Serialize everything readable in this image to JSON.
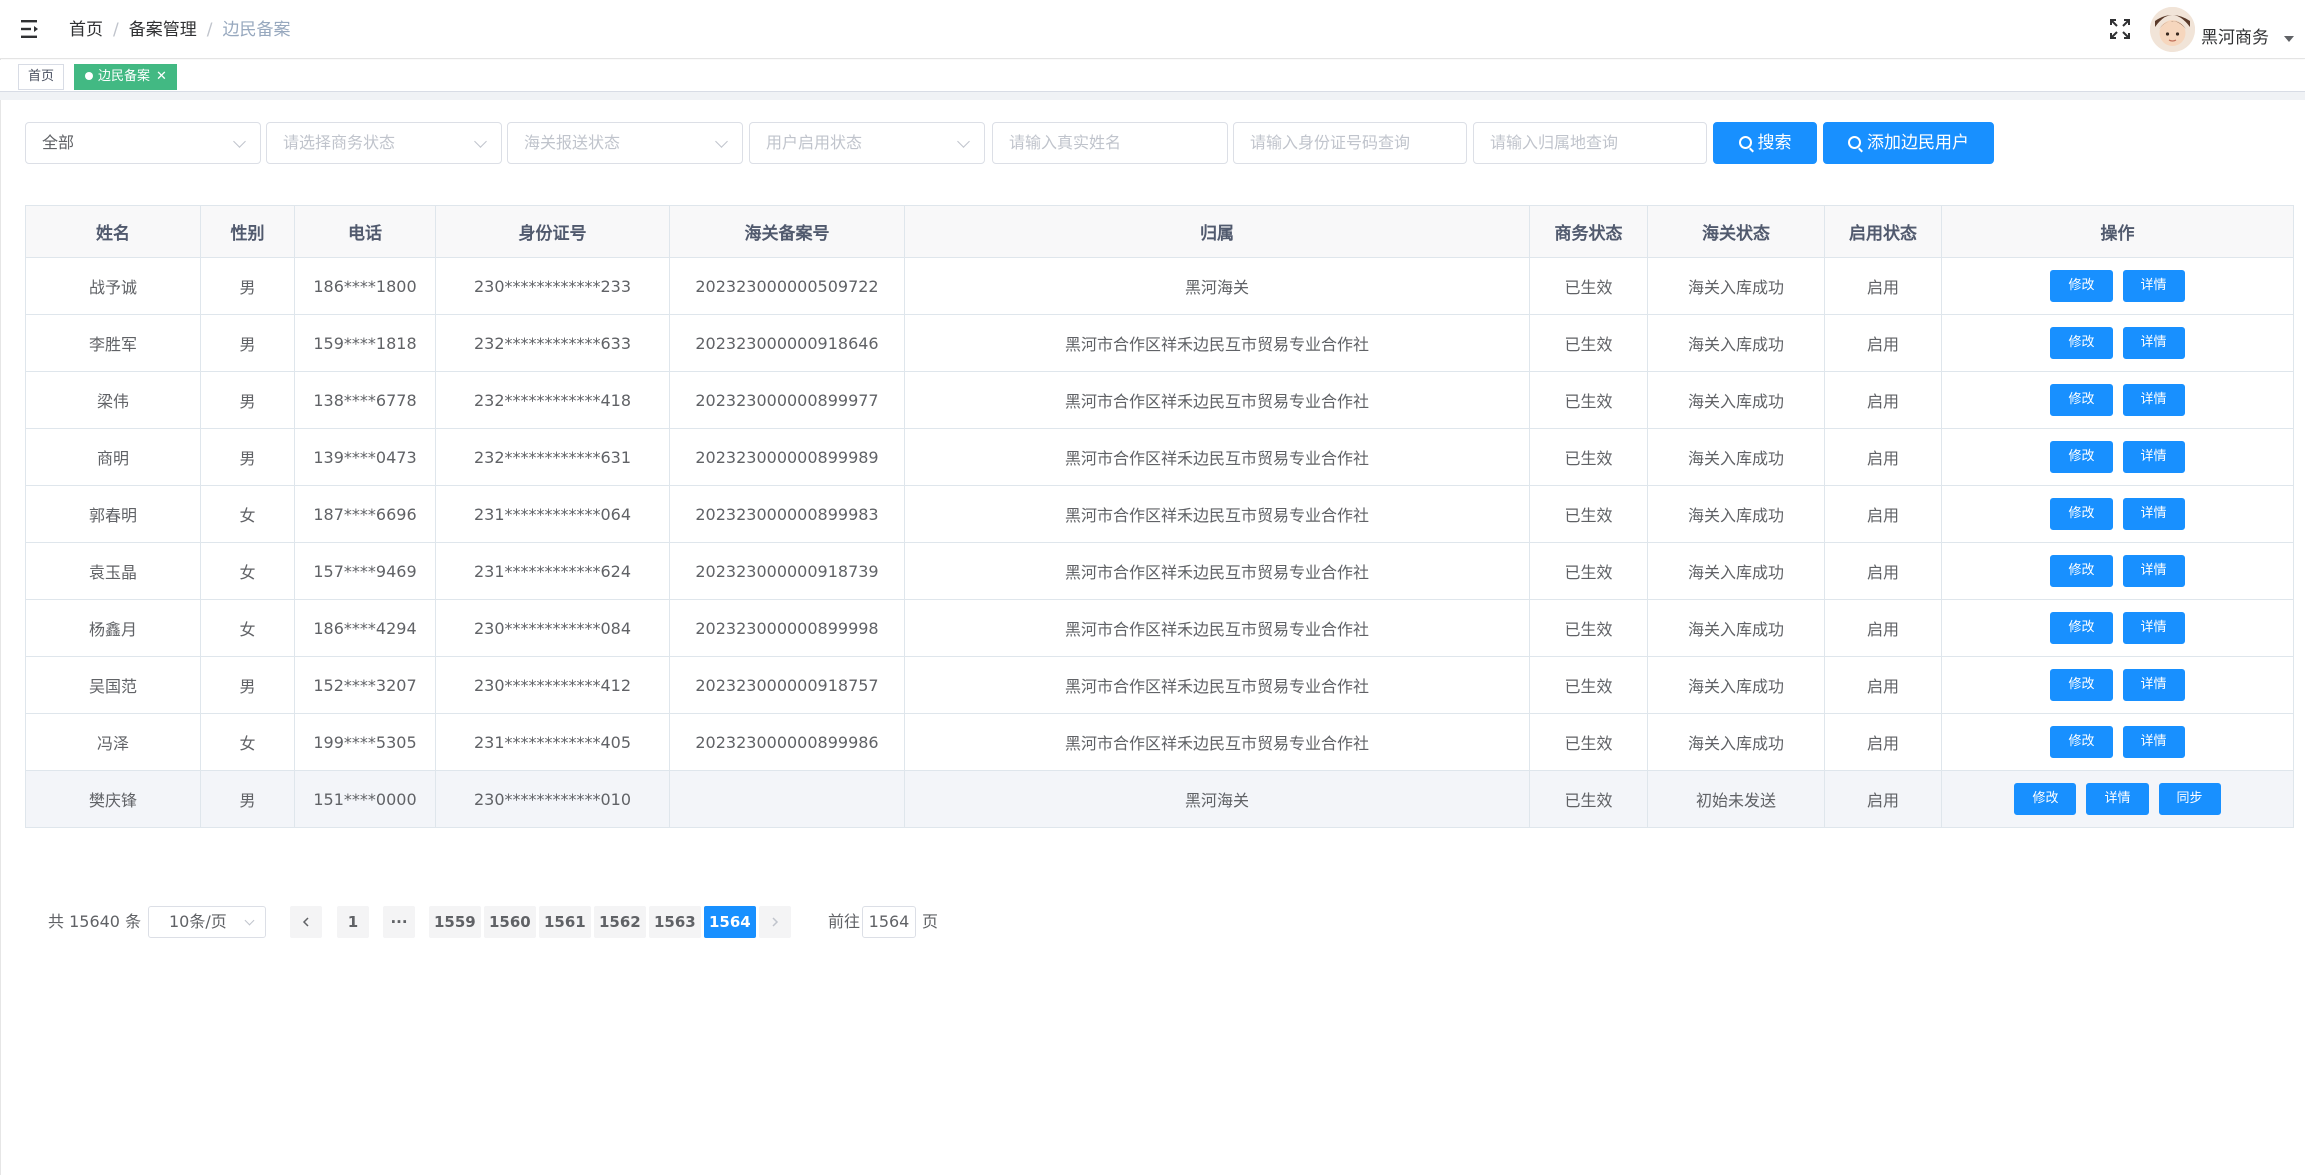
{
  "header": {
    "breadcrumb": [
      "首页",
      "备案管理",
      "边民备案"
    ],
    "username": "黑河商务"
  },
  "tags": {
    "home": "首页",
    "active": "边民备案",
    "close": "✕"
  },
  "filters": {
    "category": "全部",
    "business_status_placeholder": "请选择商务状态",
    "customs_status_placeholder": "海关报送状态",
    "user_enabled_placeholder": "用户启用状态",
    "real_name_placeholder": "请输入真实姓名",
    "id_number_placeholder": "请输入身份证号码查询",
    "affiliation_placeholder": "请输入归属地查询",
    "search_label": "搜索",
    "add_label": "添加边民用户"
  },
  "table": {
    "headers": [
      "姓名",
      "性别",
      "电话",
      "身份证号",
      "海关备案号",
      "归属",
      "商务状态",
      "海关状态",
      "启用状态",
      "操作"
    ],
    "rows": [
      {
        "name": "战予诚",
        "gender": "男",
        "phone": "186****1800",
        "id": "230************233",
        "customs_no": "202323000000509722",
        "affiliation": "黑河海关",
        "biz": "已生效",
        "customs": "海关入库成功",
        "enabled": "启用"
      },
      {
        "name": "李胜军",
        "gender": "男",
        "phone": "159****1818",
        "id": "232************633",
        "customs_no": "202323000000918646",
        "affiliation": "黑河市合作区祥禾边民互市贸易专业合作社",
        "biz": "已生效",
        "customs": "海关入库成功",
        "enabled": "启用"
      },
      {
        "name": "梁伟",
        "gender": "男",
        "phone": "138****6778",
        "id": "232************418",
        "customs_no": "202323000000899977",
        "affiliation": "黑河市合作区祥禾边民互市贸易专业合作社",
        "biz": "已生效",
        "customs": "海关入库成功",
        "enabled": "启用"
      },
      {
        "name": "商明",
        "gender": "男",
        "phone": "139****0473",
        "id": "232************631",
        "customs_no": "202323000000899989",
        "affiliation": "黑河市合作区祥禾边民互市贸易专业合作社",
        "biz": "已生效",
        "customs": "海关入库成功",
        "enabled": "启用"
      },
      {
        "name": "郭春明",
        "gender": "女",
        "phone": "187****6696",
        "id": "231************064",
        "customs_no": "202323000000899983",
        "affiliation": "黑河市合作区祥禾边民互市贸易专业合作社",
        "biz": "已生效",
        "customs": "海关入库成功",
        "enabled": "启用"
      },
      {
        "name": "袁玉晶",
        "gender": "女",
        "phone": "157****9469",
        "id": "231************624",
        "customs_no": "202323000000918739",
        "affiliation": "黑河市合作区祥禾边民互市贸易专业合作社",
        "biz": "已生效",
        "customs": "海关入库成功",
        "enabled": "启用"
      },
      {
        "name": "杨鑫月",
        "gender": "女",
        "phone": "186****4294",
        "id": "230************084",
        "customs_no": "202323000000899998",
        "affiliation": "黑河市合作区祥禾边民互市贸易专业合作社",
        "biz": "已生效",
        "customs": "海关入库成功",
        "enabled": "启用"
      },
      {
        "name": "吴国范",
        "gender": "男",
        "phone": "152****3207",
        "id": "230************412",
        "customs_no": "202323000000918757",
        "affiliation": "黑河市合作区祥禾边民互市贸易专业合作社",
        "biz": "已生效",
        "customs": "海关入库成功",
        "enabled": "启用"
      },
      {
        "name": "冯泽",
        "gender": "女",
        "phone": "199****5305",
        "id": "231************405",
        "customs_no": "202323000000899986",
        "affiliation": "黑河市合作区祥禾边民互市贸易专业合作社",
        "biz": "已生效",
        "customs": "海关入库成功",
        "enabled": "启用"
      },
      {
        "name": "樊庆锋",
        "gender": "男",
        "phone": "151****0000",
        "id": "230************010",
        "customs_no": "",
        "affiliation": "黑河海关",
        "biz": "已生效",
        "customs": "初始未发送",
        "enabled": "启用"
      }
    ],
    "actions": {
      "edit": "修改",
      "detail": "详情",
      "sync": "同步"
    }
  },
  "pagination": {
    "total": "共 15640 条",
    "page_size": "10条/页",
    "pages": [
      "1",
      "···",
      "1559",
      "1560",
      "1561",
      "1562",
      "1563",
      "1564"
    ],
    "current": "1564",
    "goto_label": "前往",
    "goto_value": "1564",
    "unit": "页"
  }
}
